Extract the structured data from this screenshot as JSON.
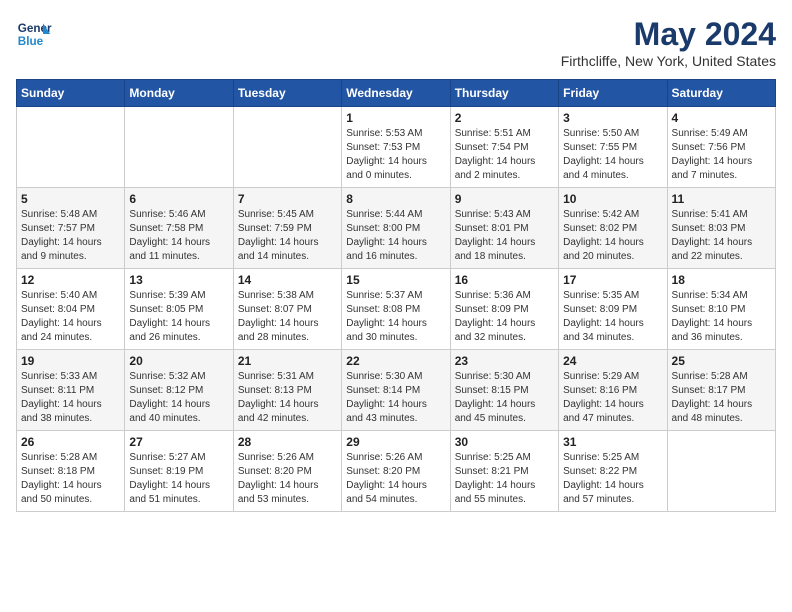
{
  "header": {
    "logo_line1": "General",
    "logo_line2": "Blue",
    "month_year": "May 2024",
    "location": "Firthcliffe, New York, United States"
  },
  "weekdays": [
    "Sunday",
    "Monday",
    "Tuesday",
    "Wednesday",
    "Thursday",
    "Friday",
    "Saturday"
  ],
  "weeks": [
    [
      {
        "day": "",
        "info": ""
      },
      {
        "day": "",
        "info": ""
      },
      {
        "day": "",
        "info": ""
      },
      {
        "day": "1",
        "info": "Sunrise: 5:53 AM\nSunset: 7:53 PM\nDaylight: 14 hours\nand 0 minutes."
      },
      {
        "day": "2",
        "info": "Sunrise: 5:51 AM\nSunset: 7:54 PM\nDaylight: 14 hours\nand 2 minutes."
      },
      {
        "day": "3",
        "info": "Sunrise: 5:50 AM\nSunset: 7:55 PM\nDaylight: 14 hours\nand 4 minutes."
      },
      {
        "day": "4",
        "info": "Sunrise: 5:49 AM\nSunset: 7:56 PM\nDaylight: 14 hours\nand 7 minutes."
      }
    ],
    [
      {
        "day": "5",
        "info": "Sunrise: 5:48 AM\nSunset: 7:57 PM\nDaylight: 14 hours\nand 9 minutes."
      },
      {
        "day": "6",
        "info": "Sunrise: 5:46 AM\nSunset: 7:58 PM\nDaylight: 14 hours\nand 11 minutes."
      },
      {
        "day": "7",
        "info": "Sunrise: 5:45 AM\nSunset: 7:59 PM\nDaylight: 14 hours\nand 14 minutes."
      },
      {
        "day": "8",
        "info": "Sunrise: 5:44 AM\nSunset: 8:00 PM\nDaylight: 14 hours\nand 16 minutes."
      },
      {
        "day": "9",
        "info": "Sunrise: 5:43 AM\nSunset: 8:01 PM\nDaylight: 14 hours\nand 18 minutes."
      },
      {
        "day": "10",
        "info": "Sunrise: 5:42 AM\nSunset: 8:02 PM\nDaylight: 14 hours\nand 20 minutes."
      },
      {
        "day": "11",
        "info": "Sunrise: 5:41 AM\nSunset: 8:03 PM\nDaylight: 14 hours\nand 22 minutes."
      }
    ],
    [
      {
        "day": "12",
        "info": "Sunrise: 5:40 AM\nSunset: 8:04 PM\nDaylight: 14 hours\nand 24 minutes."
      },
      {
        "day": "13",
        "info": "Sunrise: 5:39 AM\nSunset: 8:05 PM\nDaylight: 14 hours\nand 26 minutes."
      },
      {
        "day": "14",
        "info": "Sunrise: 5:38 AM\nSunset: 8:07 PM\nDaylight: 14 hours\nand 28 minutes."
      },
      {
        "day": "15",
        "info": "Sunrise: 5:37 AM\nSunset: 8:08 PM\nDaylight: 14 hours\nand 30 minutes."
      },
      {
        "day": "16",
        "info": "Sunrise: 5:36 AM\nSunset: 8:09 PM\nDaylight: 14 hours\nand 32 minutes."
      },
      {
        "day": "17",
        "info": "Sunrise: 5:35 AM\nSunset: 8:09 PM\nDaylight: 14 hours\nand 34 minutes."
      },
      {
        "day": "18",
        "info": "Sunrise: 5:34 AM\nSunset: 8:10 PM\nDaylight: 14 hours\nand 36 minutes."
      }
    ],
    [
      {
        "day": "19",
        "info": "Sunrise: 5:33 AM\nSunset: 8:11 PM\nDaylight: 14 hours\nand 38 minutes."
      },
      {
        "day": "20",
        "info": "Sunrise: 5:32 AM\nSunset: 8:12 PM\nDaylight: 14 hours\nand 40 minutes."
      },
      {
        "day": "21",
        "info": "Sunrise: 5:31 AM\nSunset: 8:13 PM\nDaylight: 14 hours\nand 42 minutes."
      },
      {
        "day": "22",
        "info": "Sunrise: 5:30 AM\nSunset: 8:14 PM\nDaylight: 14 hours\nand 43 minutes."
      },
      {
        "day": "23",
        "info": "Sunrise: 5:30 AM\nSunset: 8:15 PM\nDaylight: 14 hours\nand 45 minutes."
      },
      {
        "day": "24",
        "info": "Sunrise: 5:29 AM\nSunset: 8:16 PM\nDaylight: 14 hours\nand 47 minutes."
      },
      {
        "day": "25",
        "info": "Sunrise: 5:28 AM\nSunset: 8:17 PM\nDaylight: 14 hours\nand 48 minutes."
      }
    ],
    [
      {
        "day": "26",
        "info": "Sunrise: 5:28 AM\nSunset: 8:18 PM\nDaylight: 14 hours\nand 50 minutes."
      },
      {
        "day": "27",
        "info": "Sunrise: 5:27 AM\nSunset: 8:19 PM\nDaylight: 14 hours\nand 51 minutes."
      },
      {
        "day": "28",
        "info": "Sunrise: 5:26 AM\nSunset: 8:20 PM\nDaylight: 14 hours\nand 53 minutes."
      },
      {
        "day": "29",
        "info": "Sunrise: 5:26 AM\nSunset: 8:20 PM\nDaylight: 14 hours\nand 54 minutes."
      },
      {
        "day": "30",
        "info": "Sunrise: 5:25 AM\nSunset: 8:21 PM\nDaylight: 14 hours\nand 55 minutes."
      },
      {
        "day": "31",
        "info": "Sunrise: 5:25 AM\nSunset: 8:22 PM\nDaylight: 14 hours\nand 57 minutes."
      },
      {
        "day": "",
        "info": ""
      }
    ]
  ]
}
